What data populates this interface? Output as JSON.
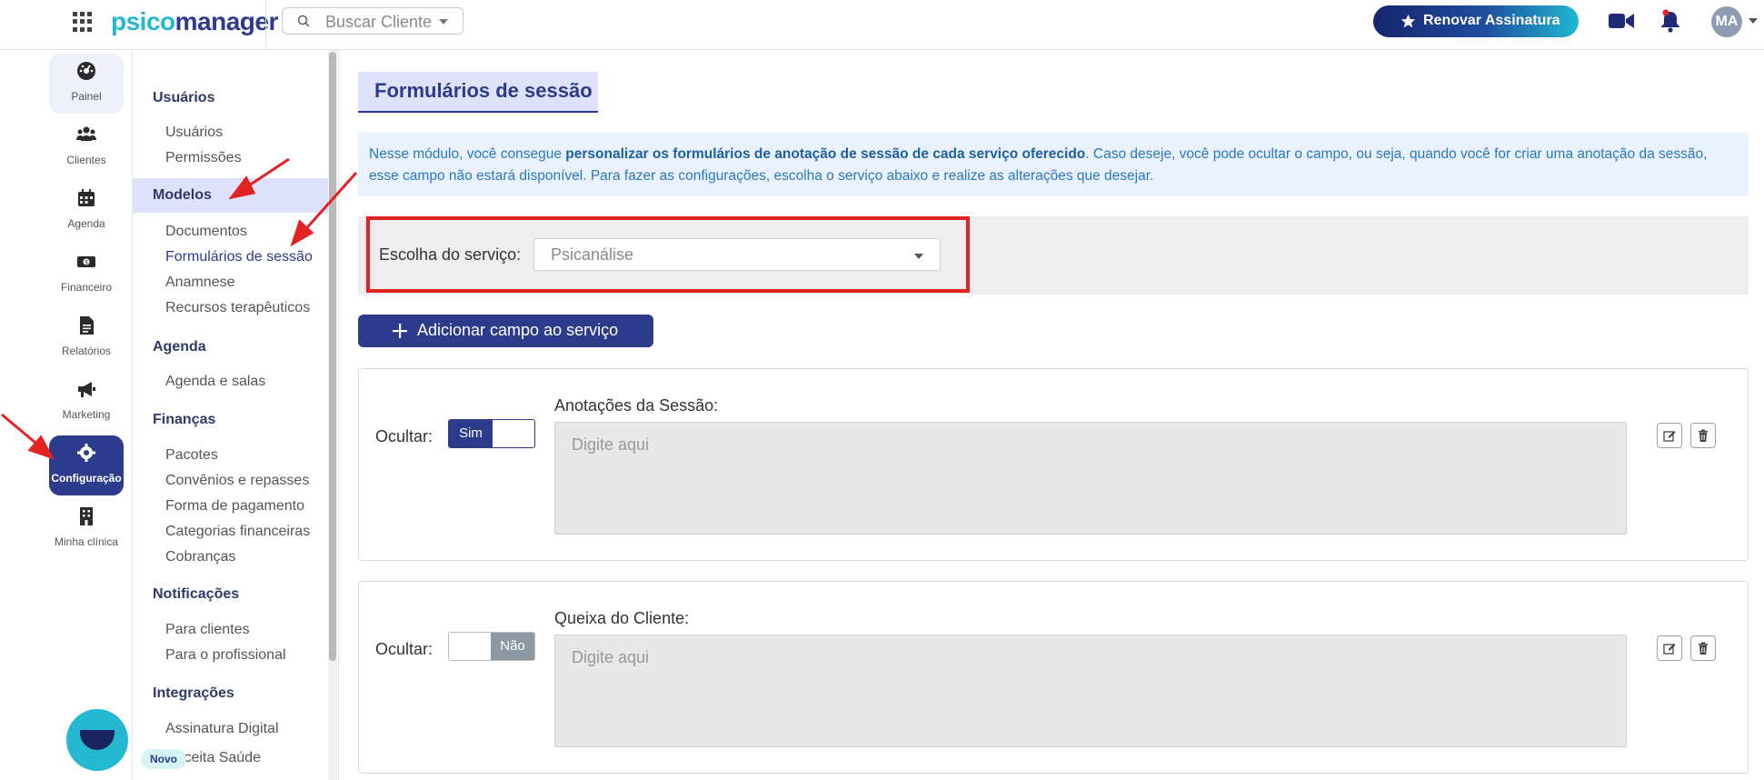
{
  "header": {
    "logo_part1": "psico",
    "logo_part2": "manager",
    "search_placeholder": "Buscar Cliente",
    "renew_label": "Renovar Assinatura",
    "avatar_initials": "MA"
  },
  "rail": {
    "items": [
      {
        "label": "Painel",
        "icon": "dashboard-icon"
      },
      {
        "label": "Clientes",
        "icon": "users-icon"
      },
      {
        "label": "Agenda",
        "icon": "calendar-icon"
      },
      {
        "label": "Financeiro",
        "icon": "money-icon"
      },
      {
        "label": "Relatórios",
        "icon": "report-icon"
      },
      {
        "label": "Marketing",
        "icon": "megaphone-icon"
      },
      {
        "label": "Configuração",
        "icon": "gear-icon"
      },
      {
        "label": "Minha clínica",
        "icon": "building-icon"
      }
    ]
  },
  "subnav": {
    "usuarios_head": "Usuários",
    "usuarios_items": [
      "Usuários",
      "Permissões"
    ],
    "modelos_head": "Modelos",
    "modelos_items": [
      "Documentos",
      "Formulários de sessão",
      "Anamnese",
      "Recursos terapêuticos"
    ],
    "agenda_head": "Agenda",
    "agenda_items": [
      "Agenda e salas"
    ],
    "financas_head": "Finanças",
    "financas_items": [
      "Pacotes",
      "Convênios e repasses",
      "Forma de pagamento",
      "Categorias financeiras",
      "Cobranças"
    ],
    "notificacoes_head": "Notificações",
    "notificacoes_items": [
      "Para clientes",
      "Para o profissional"
    ],
    "integracoes_head": "Integrações",
    "integracoes_items": [
      "Assinatura Digital",
      "Receita Saúde"
    ],
    "novo_badge": "Novo"
  },
  "main": {
    "title": "Formulários de sessão",
    "info_part1": "Nesse módulo, você consegue ",
    "info_bold": "personalizar os formulários de anotação de sessão de cada serviço oferecido",
    "info_part2": ". Caso deseje, você pode ocultar o campo, ou seja, quando você for criar uma anotação da sessão, esse campo não estará disponível. Para fazer as configurações, escolha o serviço abaixo e realize as alterações que desejar.",
    "service_label": "Escolha do serviço:",
    "service_value": "Psicanálise",
    "add_button": "Adicionar campo ao serviço",
    "fields": [
      {
        "ocultar_label": "Ocultar:",
        "toggle": "Sim",
        "label": "Anotações da Sessão:",
        "placeholder": "Digite aqui"
      },
      {
        "ocultar_label": "Ocultar:",
        "toggle": "Não",
        "label": "Queixa do Cliente:",
        "placeholder": "Digite aqui"
      }
    ]
  },
  "colors": {
    "primary": "#2d3b8c",
    "accent": "#24b9d1",
    "annotation_red": "#e32222"
  }
}
